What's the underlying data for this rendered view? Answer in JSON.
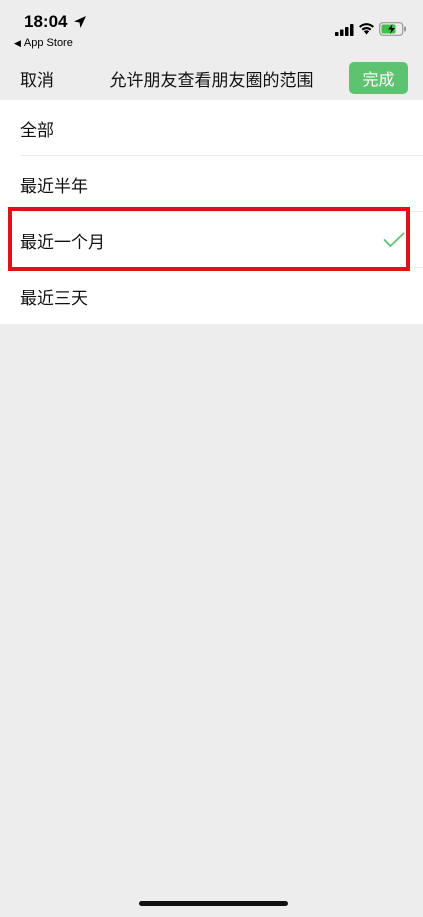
{
  "status_bar": {
    "time": "18:04",
    "back_app": "App Store"
  },
  "nav": {
    "cancel_label": "取消",
    "title": "允许朋友查看朋友圈的范围",
    "done_label": "完成"
  },
  "options": [
    {
      "label": "全部",
      "selected": false
    },
    {
      "label": "最近半年",
      "selected": false
    },
    {
      "label": "最近一个月",
      "selected": true
    },
    {
      "label": "最近三天",
      "selected": false
    }
  ],
  "colors": {
    "accent": "#5ec371",
    "highlight": "#e01119",
    "background": "#ededed"
  }
}
